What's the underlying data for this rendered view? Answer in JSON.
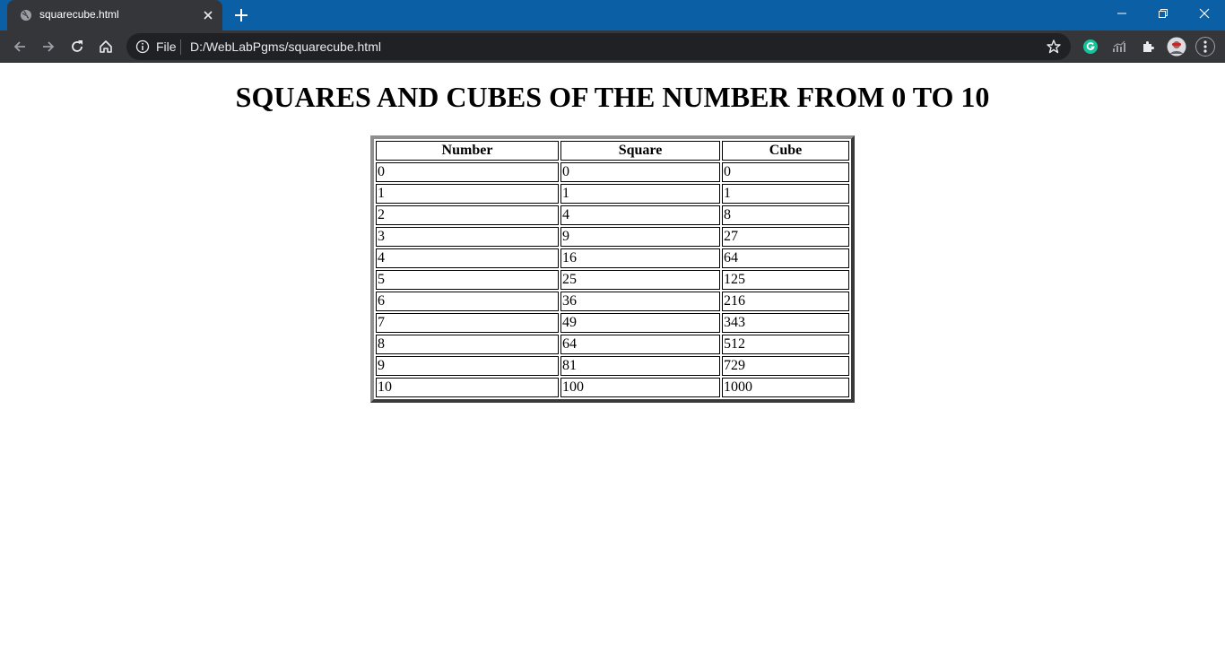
{
  "browser": {
    "tab_title": "squarecube.html",
    "address": {
      "scheme_label": "File",
      "url": "D:/WebLabPgms/squarecube.html"
    }
  },
  "page": {
    "heading": "SQUARES AND CUBES OF THE NUMBER FROM 0 TO 10",
    "table": {
      "headers": [
        "Number",
        "Square",
        "Cube"
      ],
      "rows": [
        [
          "0",
          "0",
          "0"
        ],
        [
          "1",
          "1",
          "1"
        ],
        [
          "2",
          "4",
          "8"
        ],
        [
          "3",
          "9",
          "27"
        ],
        [
          "4",
          "16",
          "64"
        ],
        [
          "5",
          "25",
          "125"
        ],
        [
          "6",
          "36",
          "216"
        ],
        [
          "7",
          "49",
          "343"
        ],
        [
          "8",
          "64",
          "512"
        ],
        [
          "9",
          "81",
          "729"
        ],
        [
          "10",
          "100",
          "1000"
        ]
      ]
    }
  },
  "colors": {
    "tabstrip": "#0b5fa5",
    "toolbar": "#35363a",
    "omnibox": "#202124",
    "grammarly": "#15c39a"
  },
  "icons": [
    "globe-icon",
    "close-icon",
    "plus-icon",
    "minimize-icon",
    "restore-icon",
    "back-icon",
    "forward-icon",
    "reload-icon",
    "home-icon",
    "info-icon",
    "star-icon",
    "grammarly-icon",
    "stats-icon",
    "puzzle-icon",
    "avatar",
    "kebab-menu-icon"
  ]
}
